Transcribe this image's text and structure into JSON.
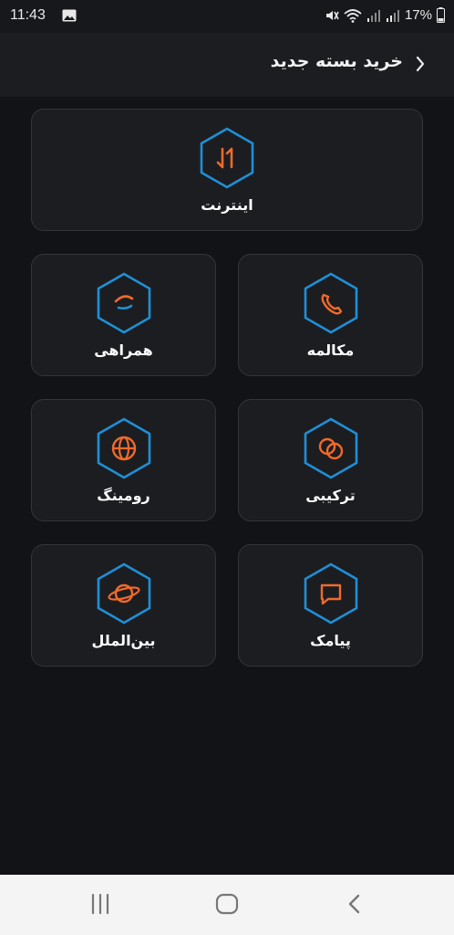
{
  "status_bar": {
    "time": "11:43",
    "battery": "17%"
  },
  "header": {
    "title": "خرید بسته جدید",
    "back_icon": "chevron-right-icon"
  },
  "packages": [
    {
      "id": "internet",
      "label": "اینترنت",
      "icon": "transfer-arrows-icon"
    },
    {
      "id": "call",
      "label": "مکالمه",
      "icon": "phone-icon"
    },
    {
      "id": "companion",
      "label": "همراهی",
      "icon": "handshake-icon"
    },
    {
      "id": "combo",
      "label": "ترکیبی",
      "icon": "overlap-circles-icon"
    },
    {
      "id": "roaming",
      "label": "رومینگ",
      "icon": "globe-icon"
    },
    {
      "id": "sms",
      "label": "پیامک",
      "icon": "message-icon"
    },
    {
      "id": "international",
      "label": "بین‌الملل",
      "icon": "planet-icon"
    }
  ],
  "colors": {
    "background": "#121316",
    "card": "#1c1d21",
    "hex_border": "#1f8fd6",
    "icon_accent": "#ef6a2a"
  }
}
